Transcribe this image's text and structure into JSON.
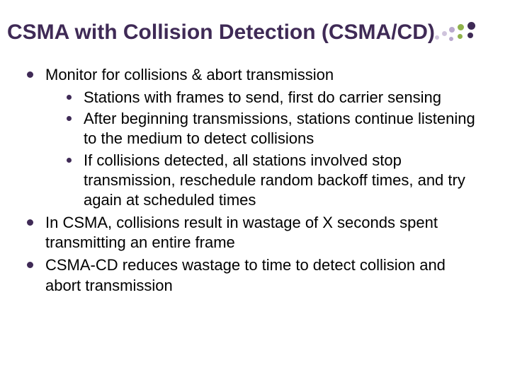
{
  "slide": {
    "title": "CSMA with Collision Detection (CSMA/CD)",
    "bullets": [
      {
        "text": "Monitor for collisions & abort transmission",
        "sub": [
          "Stations with frames to send, first do carrier sensing",
          "After beginning transmissions, stations continue listening to the medium to detect collisions",
          "If collisions detected, all stations involved stop transmission, reschedule random backoff times, and try again at scheduled times"
        ]
      },
      {
        "text": "In CSMA, collisions result in wastage of X seconds spent transmitting an entire frame",
        "sub": []
      },
      {
        "text": "CSMA-CD reduces wastage to time to detect collision and abort transmission",
        "sub": []
      }
    ],
    "colors": {
      "accent": "#3f2a56",
      "decor_green": "#8fb24a",
      "decor_purple_light": "#cfc4dc"
    }
  }
}
